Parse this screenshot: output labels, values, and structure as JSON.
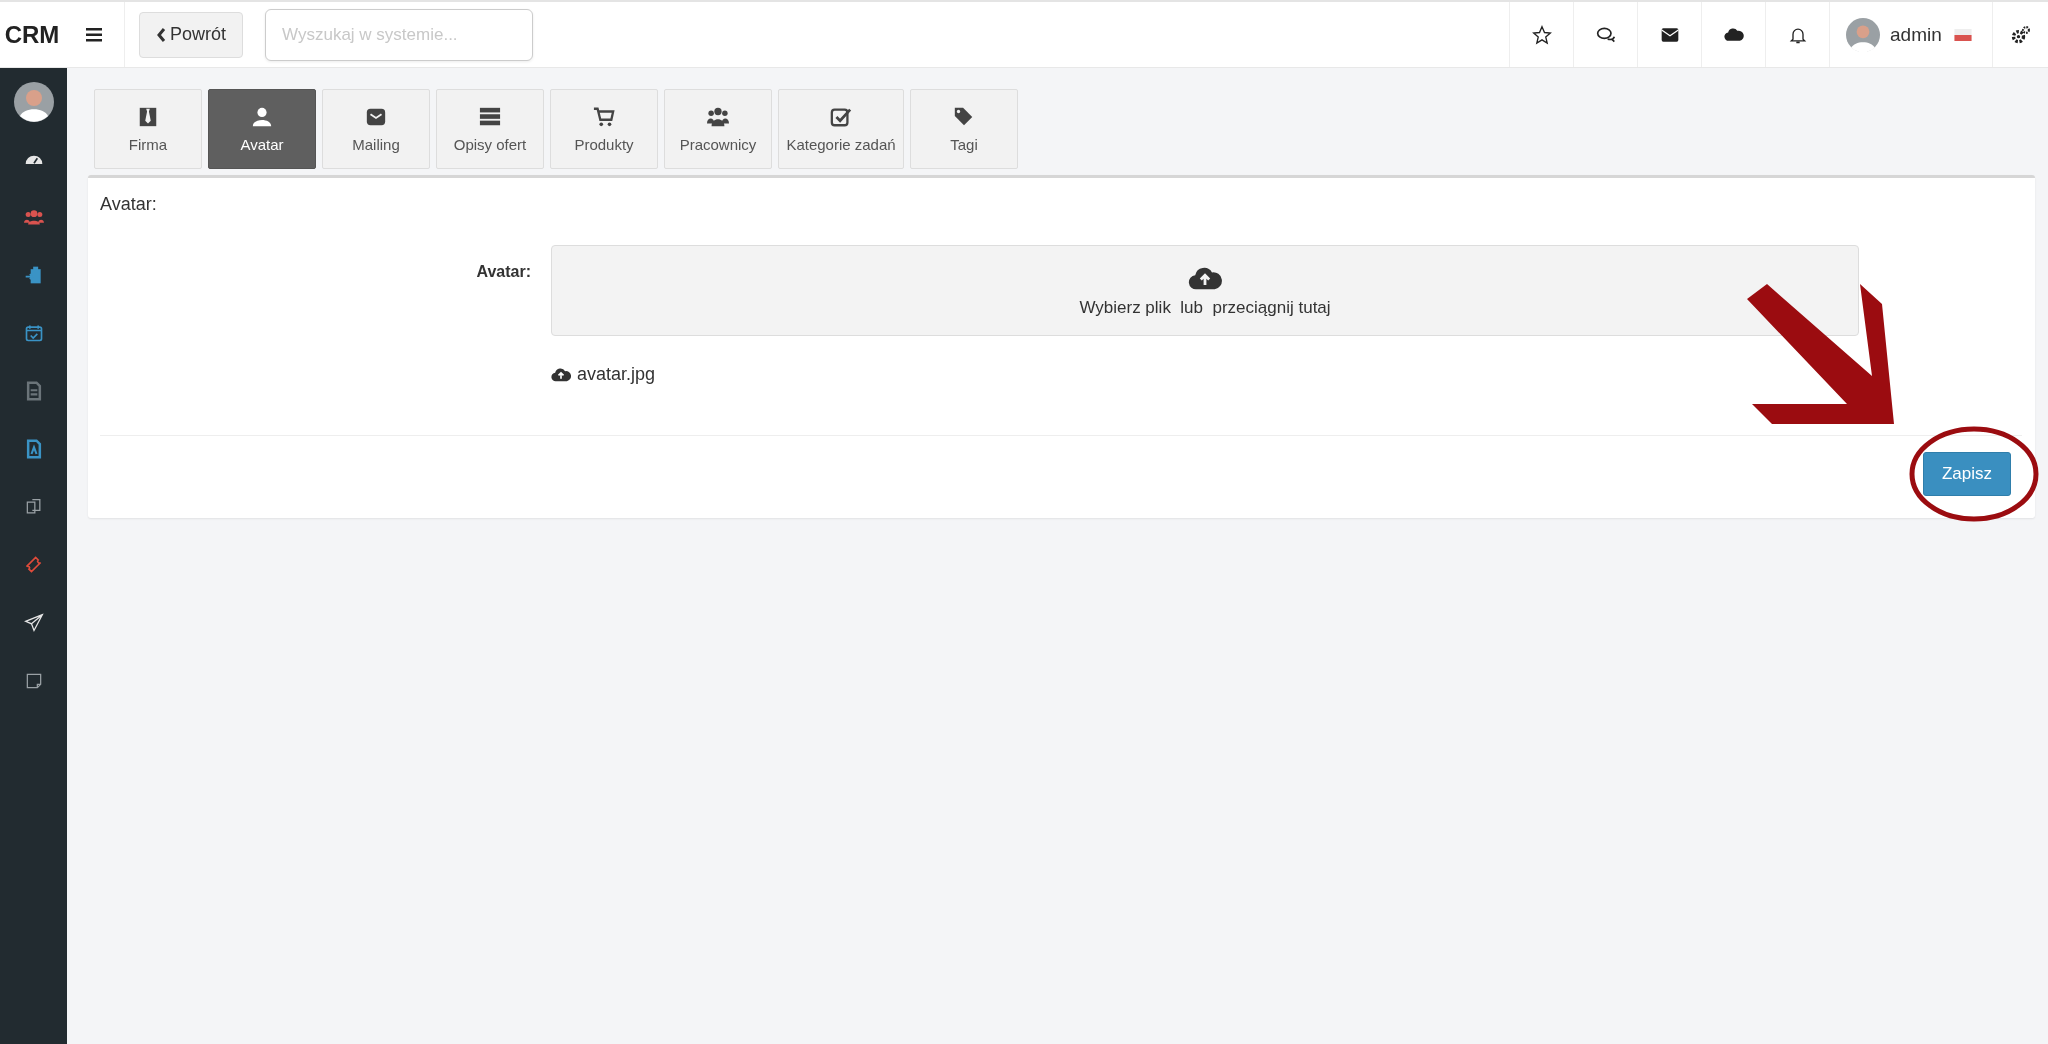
{
  "topbar": {
    "logo": "CRM",
    "back_button": "Powrót",
    "search": {
      "placeholder": "Wyszukaj w systemie..."
    },
    "icons": [
      {
        "kind": "star"
      },
      {
        "kind": "comments"
      },
      {
        "kind": "envelope"
      },
      {
        "kind": "cloud"
      },
      {
        "kind": "bell"
      }
    ],
    "user": {
      "name": "admin"
    }
  },
  "sidebar": {
    "items": [
      {
        "kind": "dashboard",
        "color": "#e6e6e6"
      },
      {
        "kind": "users",
        "color": "#d9534f"
      },
      {
        "kind": "clipboard",
        "color": "#3a93c5"
      },
      {
        "kind": "calendar",
        "color": "#3a93c5"
      },
      {
        "kind": "document",
        "color": "#6b7479"
      },
      {
        "kind": "pdf",
        "color": "#3a93c5"
      },
      {
        "kind": "copy",
        "color": "#9aa1a5"
      },
      {
        "kind": "ticket",
        "color": "#e04b3a"
      },
      {
        "kind": "send",
        "color": "#e6e6e6"
      },
      {
        "kind": "note",
        "color": "#9aa1a5"
      }
    ]
  },
  "tabs": [
    {
      "label": "Firma",
      "kind": "tie",
      "selected": false
    },
    {
      "label": "Avatar",
      "kind": "user",
      "selected": true
    },
    {
      "label": "Mailing",
      "kind": "envelope",
      "selected": false
    },
    {
      "label": "Opisy ofert",
      "kind": "server",
      "selected": false
    },
    {
      "label": "Produkty",
      "kind": "cart",
      "selected": false
    },
    {
      "label": "Pracownicy",
      "kind": "users",
      "selected": false
    },
    {
      "label": "Kategorie zadań",
      "kind": "check",
      "selected": false
    },
    {
      "label": "Tagi",
      "kind": "tags",
      "selected": false
    }
  ],
  "panel": {
    "title": "Avatar:",
    "field_label": "Avatar:",
    "dropzone": "Wybierz plik  lub  przeciągnij tutaj",
    "file": "avatar.jpg",
    "save_button": "Zapisz"
  }
}
